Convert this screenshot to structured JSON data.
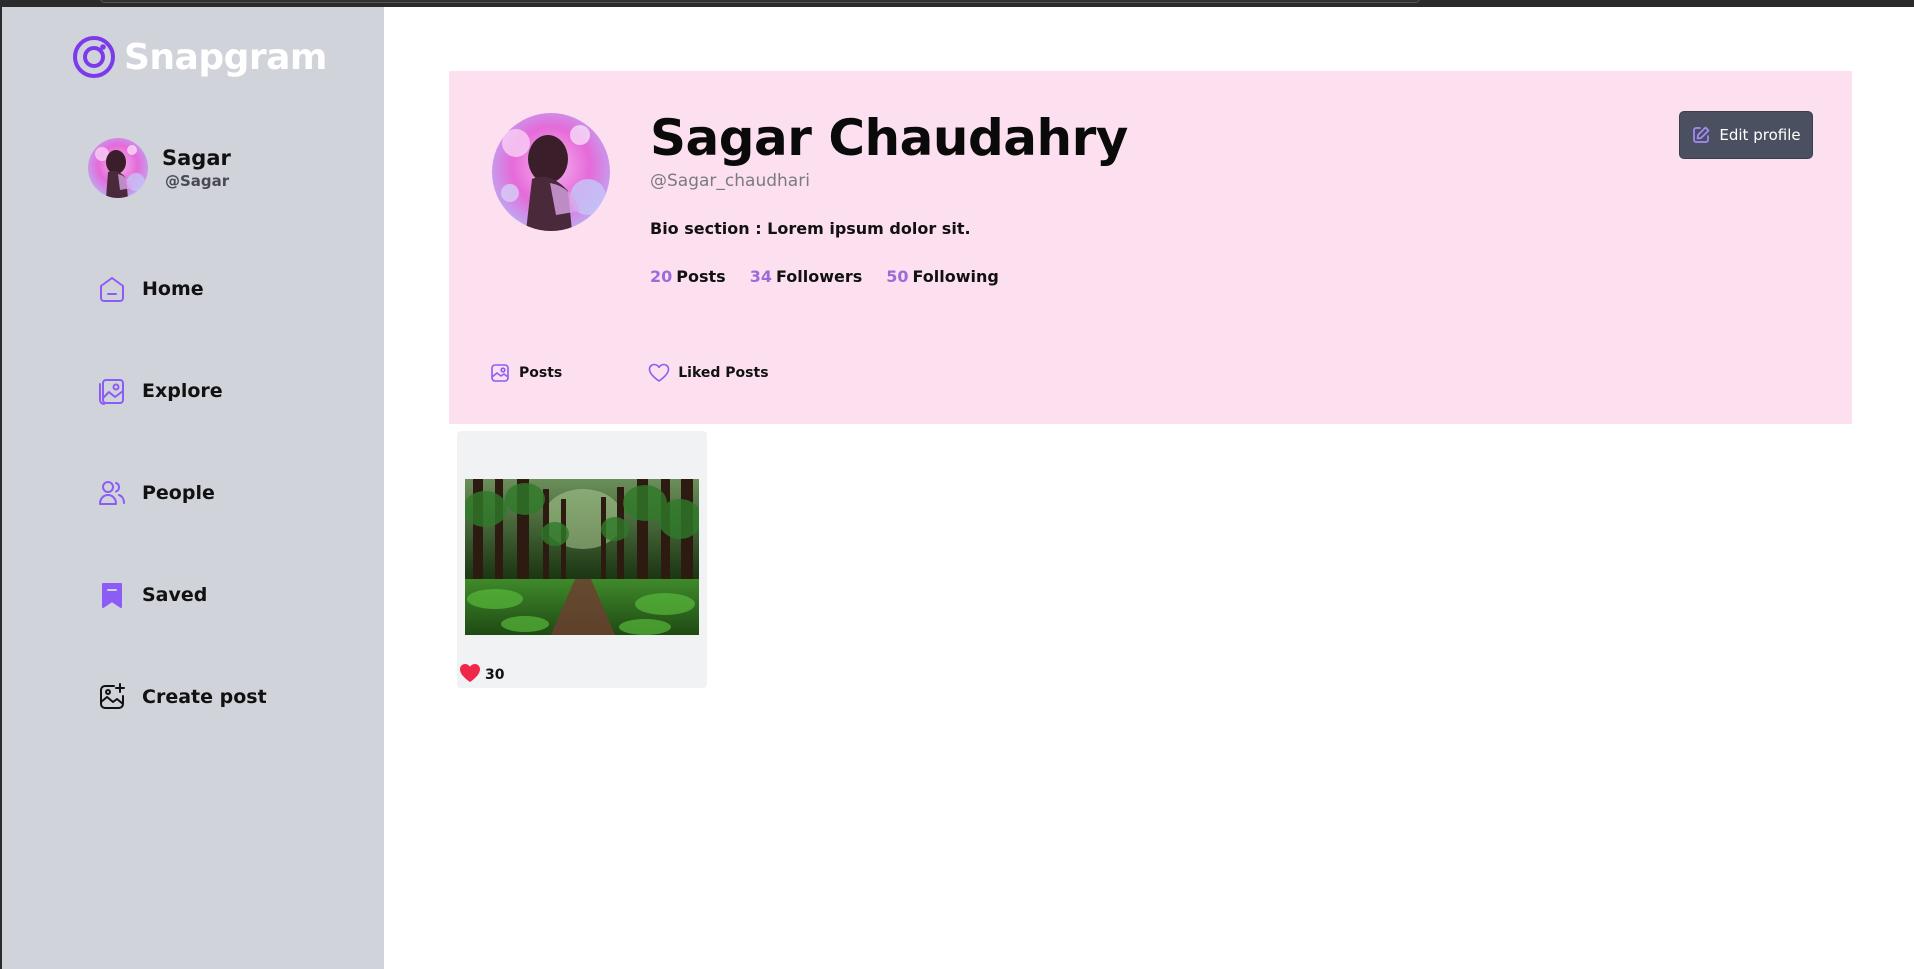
{
  "app": {
    "name": "Snapgram",
    "brand_color": "#7c3aed",
    "sidebar_bg": "#d1d3da",
    "profile_bg": "#fde0f0"
  },
  "sidebar": {
    "user": {
      "name": "Sagar",
      "handle": "@Sagar"
    },
    "items": [
      {
        "label": "Home",
        "icon": "home-icon"
      },
      {
        "label": "Explore",
        "icon": "gallery-icon"
      },
      {
        "label": "People",
        "icon": "people-icon"
      },
      {
        "label": "Saved",
        "icon": "bookmark-icon"
      },
      {
        "label": "Create post",
        "icon": "image-add-icon"
      }
    ]
  },
  "profile": {
    "full_name": "Sagar Chaudahry",
    "handle": "@Sagar_chaudhari",
    "bio": "Bio section : Lorem ipsum dolor sit.",
    "stats": [
      {
        "value": "20",
        "label": "Posts"
      },
      {
        "value": "34",
        "label": "Followers"
      },
      {
        "value": "50",
        "label": "Following"
      }
    ],
    "edit_button": "Edit profile",
    "stat_color": "#9a6cd8"
  },
  "tabs": [
    {
      "label": "Posts",
      "icon": "posts-icon"
    },
    {
      "label": "Liked Posts",
      "icon": "heart-outline-icon"
    }
  ],
  "posts": [
    {
      "likes": "30",
      "image": "forest-path-photo",
      "like_color": "#f0264a"
    }
  ]
}
